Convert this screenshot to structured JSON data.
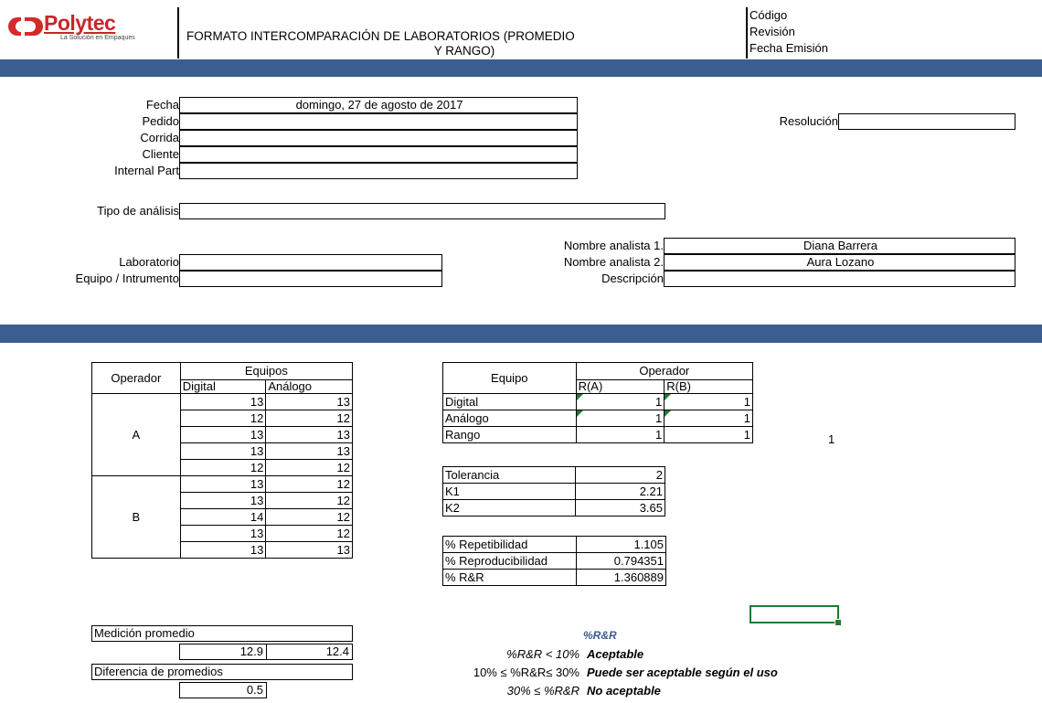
{
  "header": {
    "logo_text": "Polytec",
    "logo_tagline": "La Solución en Empaques",
    "title_line1": "FORMATO INTERCOMPARACIÓN DE LABORATORIOS (PROMEDIO",
    "title_line2": "Y RANGO)",
    "meta": [
      "Código",
      "Revisión",
      "Fecha Emisión"
    ]
  },
  "colors": {
    "band": "#3b5d8f",
    "flag": "#1e7b34",
    "legend_title": "#3b5d8f"
  },
  "form": {
    "fecha_label": "Fecha",
    "fecha_value": "domingo, 27 de agosto de 2017",
    "pedido_label": "Pedido",
    "corrida_label": "Corrida",
    "cliente_label": "Cliente",
    "internal_part_label": "Internal Part",
    "resolucion_label": "Resolución",
    "tipo_label": "Tipo de análisis",
    "laboratorio_label": "Laboratorio",
    "equipo_label": "Equipo / Intrumento",
    "analista1_label": "Nombre analista 1.",
    "analista1_value": "Diana Barrera",
    "analista2_label": "Nombre analista 2.",
    "analista2_value": "Aura Lozano",
    "descripcion_label": "Descripción"
  },
  "measurements": {
    "operador_header": "Operador",
    "equipos_header": "Equipos",
    "digital_header": "Digital",
    "analogo_header": "Análogo",
    "group_a": "A",
    "group_b": "B",
    "a_rows": [
      [
        "13",
        "13"
      ],
      [
        "12",
        "12"
      ],
      [
        "13",
        "13"
      ],
      [
        "13",
        "13"
      ],
      [
        "12",
        "12"
      ]
    ],
    "b_rows": [
      [
        "13",
        "12"
      ],
      [
        "13",
        "12"
      ],
      [
        "14",
        "12"
      ],
      [
        "13",
        "12"
      ],
      [
        "13",
        "13"
      ]
    ]
  },
  "ranges": {
    "equipo_header": "Equipo",
    "operador_header": "Operador",
    "ra_header": "R(A)",
    "rb_header": "R(B)",
    "rows": [
      {
        "label": "Digital",
        "ra": "1",
        "rb": "1"
      },
      {
        "label": "Análogo",
        "ra": "1",
        "rb": "1"
      },
      {
        "label": "Rango",
        "ra": "1",
        "rb": "1"
      }
    ],
    "side_value": "1"
  },
  "constants": {
    "rows": [
      {
        "label": "Tolerancia",
        "value": "2"
      },
      {
        "label": "K1",
        "value": "2.21"
      },
      {
        "label": "K2",
        "value": "3.65"
      }
    ]
  },
  "results": {
    "rows": [
      {
        "label": "% Repetibilidad",
        "value": "1.105"
      },
      {
        "label": "% Reproducibilidad",
        "value": "0.794351"
      },
      {
        "label": "% R&R",
        "value": "1.360889"
      }
    ]
  },
  "averages": {
    "medicion_label": "Medición promedio",
    "avg_digital": "12.9",
    "avg_analogo": "12.4",
    "diferencia_label": "Diferencia de promedios",
    "diferencia_value": "0.5"
  },
  "legend": {
    "title": "%R&R",
    "row1_cond": "%R&R < 10%",
    "row1_result": "Aceptable",
    "row2_cond": "10% ≤ %R&R≤ 30%",
    "row2_result": "Puede ser aceptable según el uso",
    "row3_cond": "30% ≤ %R&R",
    "row3_result": "No aceptable"
  }
}
